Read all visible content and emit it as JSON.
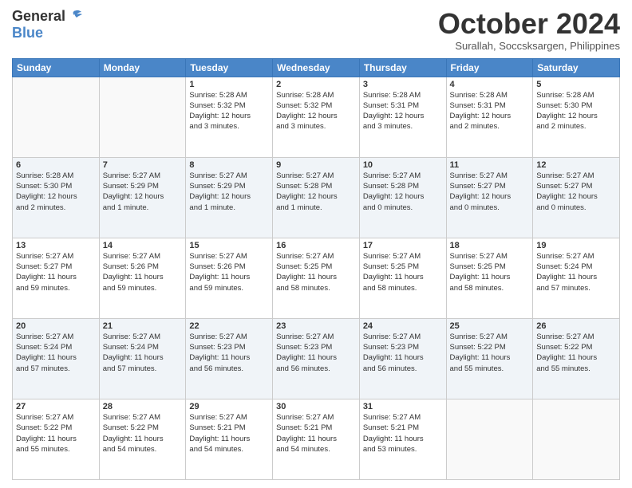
{
  "header": {
    "logo_main": "General",
    "logo_accent": "Blue",
    "month_title": "October 2024",
    "subtitle": "Surallah, Soccsksargen, Philippines"
  },
  "weekdays": [
    "Sunday",
    "Monday",
    "Tuesday",
    "Wednesday",
    "Thursday",
    "Friday",
    "Saturday"
  ],
  "weeks": [
    [
      {
        "day": "",
        "info": ""
      },
      {
        "day": "",
        "info": ""
      },
      {
        "day": "1",
        "info": "Sunrise: 5:28 AM\nSunset: 5:32 PM\nDaylight: 12 hours\nand 3 minutes."
      },
      {
        "day": "2",
        "info": "Sunrise: 5:28 AM\nSunset: 5:32 PM\nDaylight: 12 hours\nand 3 minutes."
      },
      {
        "day": "3",
        "info": "Sunrise: 5:28 AM\nSunset: 5:31 PM\nDaylight: 12 hours\nand 3 minutes."
      },
      {
        "day": "4",
        "info": "Sunrise: 5:28 AM\nSunset: 5:31 PM\nDaylight: 12 hours\nand 2 minutes."
      },
      {
        "day": "5",
        "info": "Sunrise: 5:28 AM\nSunset: 5:30 PM\nDaylight: 12 hours\nand 2 minutes."
      }
    ],
    [
      {
        "day": "6",
        "info": "Sunrise: 5:28 AM\nSunset: 5:30 PM\nDaylight: 12 hours\nand 2 minutes."
      },
      {
        "day": "7",
        "info": "Sunrise: 5:27 AM\nSunset: 5:29 PM\nDaylight: 12 hours\nand 1 minute."
      },
      {
        "day": "8",
        "info": "Sunrise: 5:27 AM\nSunset: 5:29 PM\nDaylight: 12 hours\nand 1 minute."
      },
      {
        "day": "9",
        "info": "Sunrise: 5:27 AM\nSunset: 5:28 PM\nDaylight: 12 hours\nand 1 minute."
      },
      {
        "day": "10",
        "info": "Sunrise: 5:27 AM\nSunset: 5:28 PM\nDaylight: 12 hours\nand 0 minutes."
      },
      {
        "day": "11",
        "info": "Sunrise: 5:27 AM\nSunset: 5:27 PM\nDaylight: 12 hours\nand 0 minutes."
      },
      {
        "day": "12",
        "info": "Sunrise: 5:27 AM\nSunset: 5:27 PM\nDaylight: 12 hours\nand 0 minutes."
      }
    ],
    [
      {
        "day": "13",
        "info": "Sunrise: 5:27 AM\nSunset: 5:27 PM\nDaylight: 11 hours\nand 59 minutes."
      },
      {
        "day": "14",
        "info": "Sunrise: 5:27 AM\nSunset: 5:26 PM\nDaylight: 11 hours\nand 59 minutes."
      },
      {
        "day": "15",
        "info": "Sunrise: 5:27 AM\nSunset: 5:26 PM\nDaylight: 11 hours\nand 59 minutes."
      },
      {
        "day": "16",
        "info": "Sunrise: 5:27 AM\nSunset: 5:25 PM\nDaylight: 11 hours\nand 58 minutes."
      },
      {
        "day": "17",
        "info": "Sunrise: 5:27 AM\nSunset: 5:25 PM\nDaylight: 11 hours\nand 58 minutes."
      },
      {
        "day": "18",
        "info": "Sunrise: 5:27 AM\nSunset: 5:25 PM\nDaylight: 11 hours\nand 58 minutes."
      },
      {
        "day": "19",
        "info": "Sunrise: 5:27 AM\nSunset: 5:24 PM\nDaylight: 11 hours\nand 57 minutes."
      }
    ],
    [
      {
        "day": "20",
        "info": "Sunrise: 5:27 AM\nSunset: 5:24 PM\nDaylight: 11 hours\nand 57 minutes."
      },
      {
        "day": "21",
        "info": "Sunrise: 5:27 AM\nSunset: 5:24 PM\nDaylight: 11 hours\nand 57 minutes."
      },
      {
        "day": "22",
        "info": "Sunrise: 5:27 AM\nSunset: 5:23 PM\nDaylight: 11 hours\nand 56 minutes."
      },
      {
        "day": "23",
        "info": "Sunrise: 5:27 AM\nSunset: 5:23 PM\nDaylight: 11 hours\nand 56 minutes."
      },
      {
        "day": "24",
        "info": "Sunrise: 5:27 AM\nSunset: 5:23 PM\nDaylight: 11 hours\nand 56 minutes."
      },
      {
        "day": "25",
        "info": "Sunrise: 5:27 AM\nSunset: 5:22 PM\nDaylight: 11 hours\nand 55 minutes."
      },
      {
        "day": "26",
        "info": "Sunrise: 5:27 AM\nSunset: 5:22 PM\nDaylight: 11 hours\nand 55 minutes."
      }
    ],
    [
      {
        "day": "27",
        "info": "Sunrise: 5:27 AM\nSunset: 5:22 PM\nDaylight: 11 hours\nand 55 minutes."
      },
      {
        "day": "28",
        "info": "Sunrise: 5:27 AM\nSunset: 5:22 PM\nDaylight: 11 hours\nand 54 minutes."
      },
      {
        "day": "29",
        "info": "Sunrise: 5:27 AM\nSunset: 5:21 PM\nDaylight: 11 hours\nand 54 minutes."
      },
      {
        "day": "30",
        "info": "Sunrise: 5:27 AM\nSunset: 5:21 PM\nDaylight: 11 hours\nand 54 minutes."
      },
      {
        "day": "31",
        "info": "Sunrise: 5:27 AM\nSunset: 5:21 PM\nDaylight: 11 hours\nand 53 minutes."
      },
      {
        "day": "",
        "info": ""
      },
      {
        "day": "",
        "info": ""
      }
    ]
  ]
}
